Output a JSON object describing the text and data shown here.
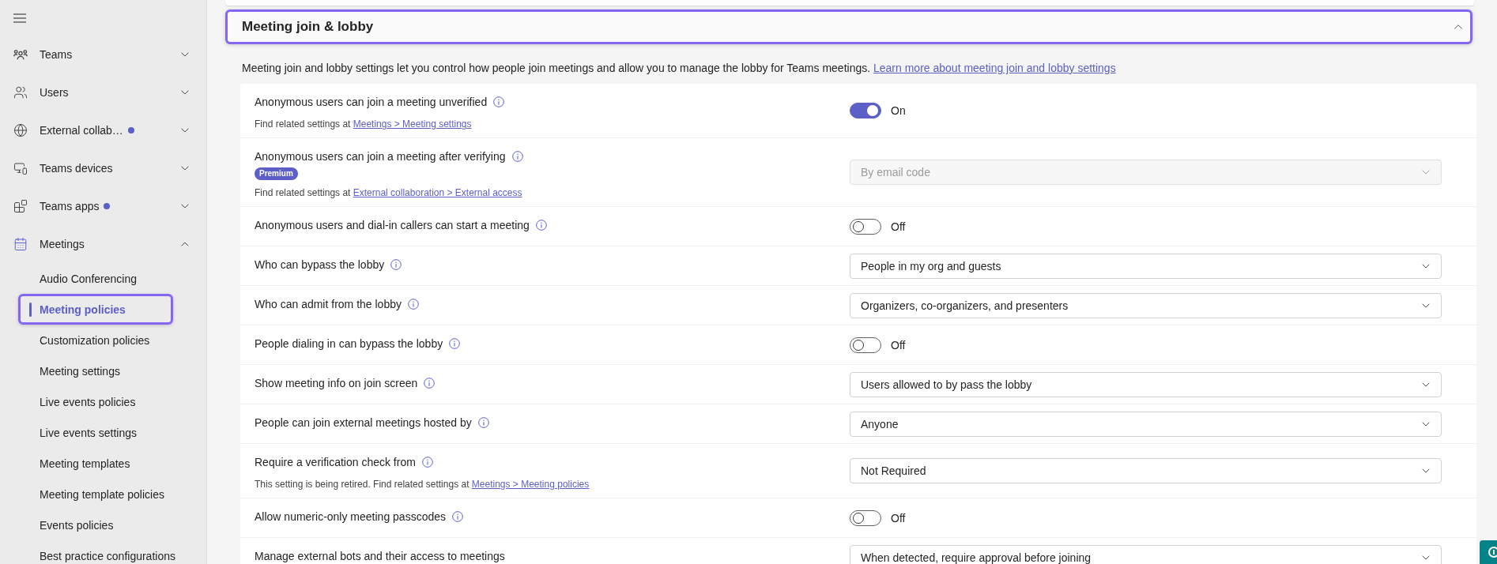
{
  "sidebar": {
    "items": [
      {
        "label": "Teams",
        "expanded": false,
        "notification": false
      },
      {
        "label": "Users",
        "expanded": false,
        "notification": false
      },
      {
        "label": "External collab…",
        "expanded": false,
        "notification": true
      },
      {
        "label": "Teams devices",
        "expanded": false,
        "notification": false
      },
      {
        "label": "Teams apps",
        "expanded": false,
        "notification": true
      },
      {
        "label": "Meetings",
        "expanded": true,
        "notification": false,
        "children": [
          {
            "label": "Audio Conferencing",
            "selected": false,
            "highlighted": false
          },
          {
            "label": "Meeting policies",
            "selected": true,
            "highlighted": true
          },
          {
            "label": "Customization policies",
            "selected": false,
            "highlighted": false
          },
          {
            "label": "Meeting settings",
            "selected": false,
            "highlighted": false
          },
          {
            "label": "Live events policies",
            "selected": false,
            "highlighted": false
          },
          {
            "label": "Live events settings",
            "selected": false,
            "highlighted": false
          },
          {
            "label": "Meeting templates",
            "selected": false,
            "highlighted": false
          },
          {
            "label": "Meeting template policies",
            "selected": false,
            "highlighted": false
          },
          {
            "label": "Events policies",
            "selected": false,
            "highlighted": false
          },
          {
            "label": "Best practice configurations",
            "selected": false,
            "highlighted": false
          }
        ]
      }
    ]
  },
  "section": {
    "title": "Meeting join & lobby",
    "expanded": true,
    "highlighted": true,
    "description": "Meeting join and lobby settings let you control how people join meetings and allow you to manage the lobby for Teams meetings.",
    "link": "Learn more about meeting join and lobby settings"
  },
  "settings": [
    {
      "label": "Anonymous users can join a meeting unverified",
      "info": true,
      "kind": "toggle",
      "on": true,
      "state_label": "On",
      "note": {
        "text": "Find related settings at",
        "link": "Meetings > Meeting settings"
      }
    },
    {
      "label": "Anonymous users can join a meeting after verifying",
      "info": true,
      "badge": "Premium",
      "kind": "dropdown",
      "value": "By email code",
      "disabled": true,
      "note": {
        "text": "Find related settings at",
        "link": "External collaboration > External access"
      }
    },
    {
      "label": "Anonymous users and dial-in callers can start a meeting",
      "info": true,
      "kind": "toggle",
      "on": false,
      "state_label": "Off"
    },
    {
      "label": "Who can bypass the lobby",
      "info": true,
      "kind": "dropdown",
      "value": "People in my org and guests",
      "disabled": false
    },
    {
      "label": "Who can admit from the lobby",
      "info": true,
      "kind": "dropdown",
      "value": "Organizers, co-organizers, and presenters",
      "disabled": false
    },
    {
      "label": "People dialing in can bypass the lobby",
      "info": true,
      "kind": "toggle",
      "on": false,
      "state_label": "Off"
    },
    {
      "label": "Show meeting info on join screen",
      "info": true,
      "kind": "dropdown",
      "value": "Users allowed to by pass the lobby",
      "disabled": false
    },
    {
      "label": "People can join external meetings hosted by",
      "info": true,
      "kind": "dropdown",
      "value": "Anyone",
      "disabled": false
    },
    {
      "label": "Require a verification check from",
      "info": true,
      "kind": "dropdown",
      "value": "Not Required",
      "disabled": false,
      "note": {
        "text": "This setting is being retired. Find related settings at",
        "link": "Meetings > Meeting policies"
      }
    },
    {
      "label": "Allow numeric-only meeting passcodes",
      "info": true,
      "kind": "toggle",
      "on": false,
      "state_label": "Off"
    },
    {
      "label": "Manage external bots and their access to meetings",
      "info": false,
      "kind": "dropdown",
      "value": "When detected, require approval before joining",
      "disabled": false
    }
  ]
}
